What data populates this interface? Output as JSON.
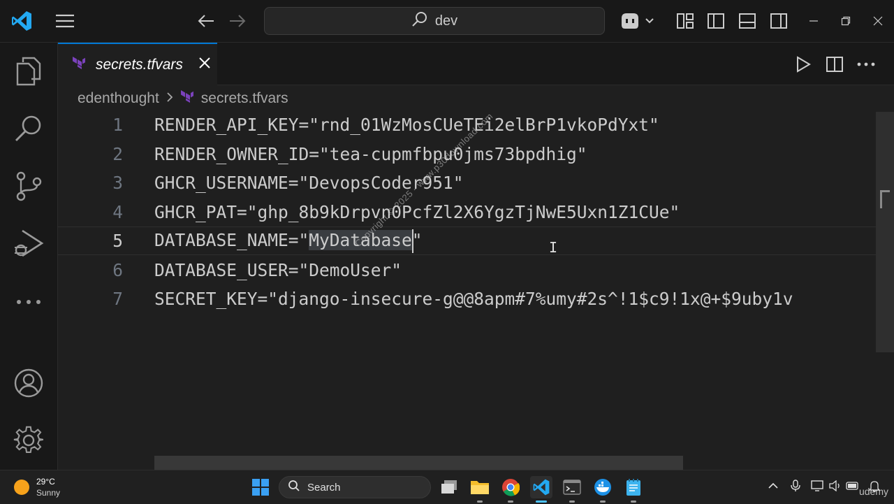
{
  "titlebar": {
    "search_text": "dev"
  },
  "tab": {
    "label": "secrets.tfvars"
  },
  "breadcrumb": {
    "folder": "edenthought",
    "file": "secrets.tfvars"
  },
  "editor": {
    "lines": [
      {
        "num": "1",
        "pre": "RENDER_API_KEY=\"rnd_01WzMosCUeTEi2elBrP1vkoPdYxt\"",
        "sel": "",
        "post": ""
      },
      {
        "num": "2",
        "pre": "RENDER_OWNER_ID=\"tea-cupmfbpu0jms73bpdhig\"",
        "sel": "",
        "post": ""
      },
      {
        "num": "3",
        "pre": "GHCR_USERNAME=\"DevopsCoder951\"",
        "sel": "",
        "post": ""
      },
      {
        "num": "4",
        "pre": "GHCR_PAT=\"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\"",
        "sel": "",
        "post": ""
      },
      {
        "num": "5",
        "pre": "DATABASE_NAME=\"",
        "sel": "MyDatabase",
        "post": "\""
      },
      {
        "num": "6",
        "pre": "DATABASE_USER=\"DemoUser\"",
        "sel": "",
        "post": ""
      },
      {
        "num": "7",
        "pre": "SECRET_KEY=\"django-insecure-g@@8apm#7%umy#2s^!1$c9!1x@+$9uby1v",
        "sel": "",
        "post": ""
      }
    ],
    "active_line": 5
  },
  "watermark": "Copyright © 2025 - www.p30download.com",
  "taskbar": {
    "weather_temp": "29°C",
    "weather_desc": "Sunny",
    "search_label": "Search",
    "watermark_brand": "udemy"
  },
  "colors": {
    "accent": "#0078d4",
    "terraform": "#7b42bc",
    "vscode_blue": "#23a9f2"
  }
}
